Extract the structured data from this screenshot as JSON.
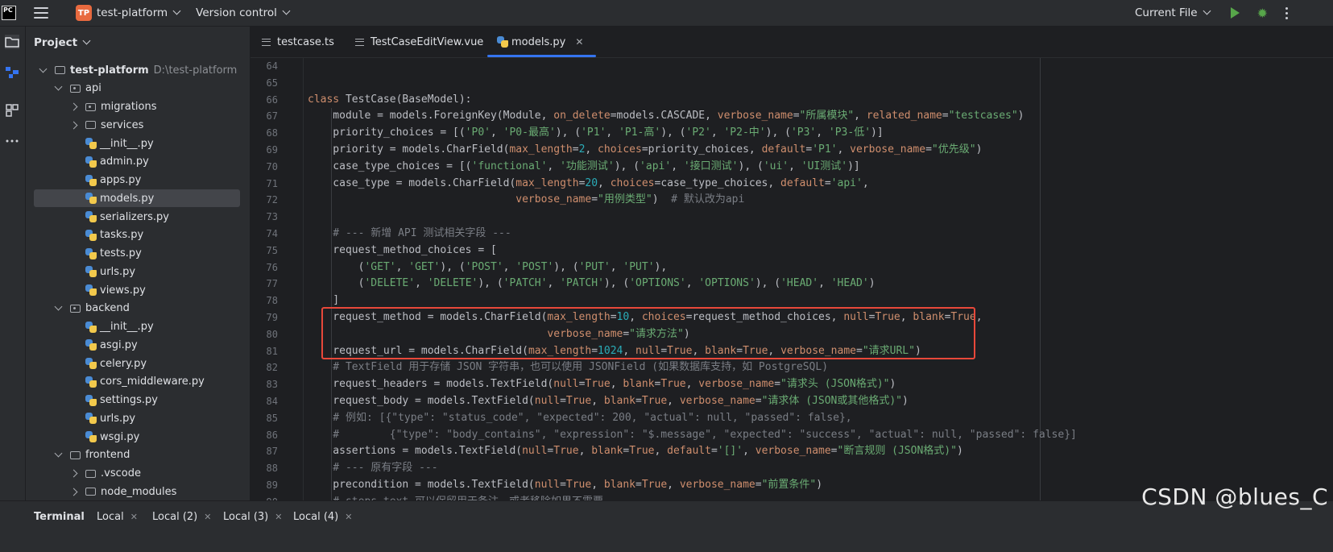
{
  "titlebar": {
    "app_logo": "PC",
    "project_badge": "TP",
    "project_name": "test-platform",
    "version_control": "Version control",
    "run_config": "Current File"
  },
  "project_panel": {
    "title": "Project",
    "tree": [
      {
        "label": "test-platform",
        "path": "D:\\test-platform",
        "type": "folder",
        "expanded": true,
        "bold": true
      },
      {
        "label": "api",
        "type": "package",
        "expanded": true
      },
      {
        "label": "migrations",
        "type": "package",
        "expanded": false
      },
      {
        "label": "services",
        "type": "folder",
        "expanded": false
      },
      {
        "label": "__init__.py",
        "type": "py"
      },
      {
        "label": "admin.py",
        "type": "py"
      },
      {
        "label": "apps.py",
        "type": "py"
      },
      {
        "label": "models.py",
        "type": "py",
        "selected": true
      },
      {
        "label": "serializers.py",
        "type": "py"
      },
      {
        "label": "tasks.py",
        "type": "py"
      },
      {
        "label": "tests.py",
        "type": "py"
      },
      {
        "label": "urls.py",
        "type": "py"
      },
      {
        "label": "views.py",
        "type": "py"
      },
      {
        "label": "backend",
        "type": "package",
        "expanded": true
      },
      {
        "label": "__init__.py",
        "type": "py"
      },
      {
        "label": "asgi.py",
        "type": "py"
      },
      {
        "label": "celery.py",
        "type": "py"
      },
      {
        "label": "cors_middleware.py",
        "type": "py"
      },
      {
        "label": "settings.py",
        "type": "py"
      },
      {
        "label": "urls.py",
        "type": "py"
      },
      {
        "label": "wsgi.py",
        "type": "py"
      },
      {
        "label": "frontend",
        "type": "folder",
        "expanded": true
      },
      {
        "label": ".vscode",
        "type": "folder",
        "expanded": false
      },
      {
        "label": "node_modules",
        "type": "folder",
        "expanded": false
      }
    ]
  },
  "tabs": [
    {
      "label": "testcase.ts",
      "active": false
    },
    {
      "label": "TestCaseEditView.vue",
      "active": false
    },
    {
      "label": "models.py",
      "active": true
    }
  ],
  "editor": {
    "lines": [
      {
        "n": "64",
        "tokens": []
      },
      {
        "n": "65",
        "tokens": []
      },
      {
        "n": "66",
        "tokens": [
          [
            "k",
            "class "
          ],
          [
            "t",
            "TestCase(BaseModel):"
          ]
        ]
      },
      {
        "n": "67",
        "tokens": [
          [
            "t",
            "    module = models.ForeignKey(Module, "
          ],
          [
            "k",
            "on_delete"
          ],
          [
            "t",
            "=models.CASCADE, "
          ],
          [
            "k",
            "verbose_name"
          ],
          [
            "t",
            "="
          ],
          [
            "s",
            "\"所属模块\""
          ],
          [
            "t",
            ", "
          ],
          [
            "k",
            "related_name"
          ],
          [
            "t",
            "="
          ],
          [
            "s",
            "\"testcases\""
          ],
          [
            "t",
            ")"
          ]
        ]
      },
      {
        "n": "68",
        "tokens": [
          [
            "t",
            "    priority_choices = [("
          ],
          [
            "s",
            "'P0'"
          ],
          [
            "t",
            ", "
          ],
          [
            "s",
            "'P0-最高'"
          ],
          [
            "t",
            "), ("
          ],
          [
            "s",
            "'P1'"
          ],
          [
            "t",
            ", "
          ],
          [
            "s",
            "'P1-高'"
          ],
          [
            "t",
            "), ("
          ],
          [
            "s",
            "'P2'"
          ],
          [
            "t",
            ", "
          ],
          [
            "s",
            "'P2-中'"
          ],
          [
            "t",
            "), ("
          ],
          [
            "s",
            "'P3'"
          ],
          [
            "t",
            ", "
          ],
          [
            "s",
            "'P3-低'"
          ],
          [
            "t",
            ")]"
          ]
        ]
      },
      {
        "n": "69",
        "tokens": [
          [
            "t",
            "    priority = models.CharField("
          ],
          [
            "k",
            "max_length"
          ],
          [
            "t",
            "="
          ],
          [
            "n",
            "2"
          ],
          [
            "t",
            ", "
          ],
          [
            "k",
            "choices"
          ],
          [
            "t",
            "=priority_choices, "
          ],
          [
            "k",
            "default"
          ],
          [
            "t",
            "="
          ],
          [
            "s",
            "'P1'"
          ],
          [
            "t",
            ", "
          ],
          [
            "k",
            "verbose_name"
          ],
          [
            "t",
            "="
          ],
          [
            "s",
            "\"优先级\""
          ],
          [
            "t",
            ")"
          ]
        ]
      },
      {
        "n": "70",
        "tokens": [
          [
            "t",
            "    case_type_choices = [("
          ],
          [
            "s",
            "'functional'"
          ],
          [
            "t",
            ", "
          ],
          [
            "s",
            "'功能测试'"
          ],
          [
            "t",
            "), ("
          ],
          [
            "s",
            "'api'"
          ],
          [
            "t",
            ", "
          ],
          [
            "s",
            "'接口测试'"
          ],
          [
            "t",
            "), ("
          ],
          [
            "s",
            "'ui'"
          ],
          [
            "t",
            ", "
          ],
          [
            "s",
            "'UI测试'"
          ],
          [
            "t",
            ")]"
          ]
        ]
      },
      {
        "n": "71",
        "tokens": [
          [
            "t",
            "    case_type = models.CharField("
          ],
          [
            "k",
            "max_length"
          ],
          [
            "t",
            "="
          ],
          [
            "n",
            "20"
          ],
          [
            "t",
            ", "
          ],
          [
            "k",
            "choices"
          ],
          [
            "t",
            "=case_type_choices, "
          ],
          [
            "k",
            "default"
          ],
          [
            "t",
            "="
          ],
          [
            "s",
            "'api'"
          ],
          [
            "t",
            ","
          ]
        ]
      },
      {
        "n": "72",
        "tokens": [
          [
            "t",
            "                                 "
          ],
          [
            "k",
            "verbose_name"
          ],
          [
            "t",
            "="
          ],
          [
            "s",
            "\"用例类型\""
          ],
          [
            "t",
            ")  "
          ],
          [
            "c",
            "# 默认改为api"
          ]
        ]
      },
      {
        "n": "73",
        "tokens": []
      },
      {
        "n": "74",
        "tokens": [
          [
            "c",
            "    # --- 新增 API 测试相关字段 ---"
          ]
        ]
      },
      {
        "n": "75",
        "tokens": [
          [
            "t",
            "    request_method_choices = ["
          ]
        ]
      },
      {
        "n": "76",
        "tokens": [
          [
            "t",
            "        ("
          ],
          [
            "s",
            "'GET'"
          ],
          [
            "t",
            ", "
          ],
          [
            "s",
            "'GET'"
          ],
          [
            "t",
            "), ("
          ],
          [
            "s",
            "'POST'"
          ],
          [
            "t",
            ", "
          ],
          [
            "s",
            "'POST'"
          ],
          [
            "t",
            "), ("
          ],
          [
            "s",
            "'PUT'"
          ],
          [
            "t",
            ", "
          ],
          [
            "s",
            "'PUT'"
          ],
          [
            "t",
            "),"
          ]
        ]
      },
      {
        "n": "77",
        "tokens": [
          [
            "t",
            "        ("
          ],
          [
            "s",
            "'DELETE'"
          ],
          [
            "t",
            ", "
          ],
          [
            "s",
            "'DELETE'"
          ],
          [
            "t",
            "), ("
          ],
          [
            "s",
            "'PATCH'"
          ],
          [
            "t",
            ", "
          ],
          [
            "s",
            "'PATCH'"
          ],
          [
            "t",
            "), ("
          ],
          [
            "s",
            "'OPTIONS'"
          ],
          [
            "t",
            ", "
          ],
          [
            "s",
            "'OPTIONS'"
          ],
          [
            "t",
            "), ("
          ],
          [
            "s",
            "'HEAD'"
          ],
          [
            "t",
            ", "
          ],
          [
            "s",
            "'HEAD'"
          ],
          [
            "t",
            ")"
          ]
        ]
      },
      {
        "n": "78",
        "tokens": [
          [
            "t",
            "    ]"
          ]
        ]
      },
      {
        "n": "79",
        "tokens": [
          [
            "t",
            "    request_method = models.CharField("
          ],
          [
            "k",
            "max_length"
          ],
          [
            "t",
            "="
          ],
          [
            "n",
            "10"
          ],
          [
            "t",
            ", "
          ],
          [
            "k",
            "choices"
          ],
          [
            "t",
            "=request_method_choices, "
          ],
          [
            "k",
            "null"
          ],
          [
            "t",
            "="
          ],
          [
            "k",
            "True"
          ],
          [
            "t",
            ", "
          ],
          [
            "k",
            "blank"
          ],
          [
            "t",
            "="
          ],
          [
            "k",
            "True"
          ],
          [
            "t",
            ","
          ]
        ]
      },
      {
        "n": "80",
        "tokens": [
          [
            "t",
            "                                      "
          ],
          [
            "k",
            "verbose_name"
          ],
          [
            "t",
            "="
          ],
          [
            "s",
            "\"请求方法\""
          ],
          [
            "t",
            ")"
          ]
        ]
      },
      {
        "n": "81",
        "tokens": [
          [
            "t",
            "    request_url = models.CharField("
          ],
          [
            "k",
            "max_length"
          ],
          [
            "t",
            "="
          ],
          [
            "n",
            "1024"
          ],
          [
            "t",
            ", "
          ],
          [
            "k",
            "null"
          ],
          [
            "t",
            "="
          ],
          [
            "k",
            "True"
          ],
          [
            "t",
            ", "
          ],
          [
            "k",
            "blank"
          ],
          [
            "t",
            "="
          ],
          [
            "k",
            "True"
          ],
          [
            "t",
            ", "
          ],
          [
            "k",
            "verbose_name"
          ],
          [
            "t",
            "="
          ],
          [
            "s",
            "\"请求URL\""
          ],
          [
            "t",
            ")"
          ]
        ]
      },
      {
        "n": "82",
        "tokens": [
          [
            "c",
            "    # TextField 用于存储 JSON 字符串，也可以使用 JSONField (如果数据库支持，如 PostgreSQL)"
          ]
        ]
      },
      {
        "n": "83",
        "tokens": [
          [
            "t",
            "    request_headers = models.TextField("
          ],
          [
            "k",
            "null"
          ],
          [
            "t",
            "="
          ],
          [
            "k",
            "True"
          ],
          [
            "t",
            ", "
          ],
          [
            "k",
            "blank"
          ],
          [
            "t",
            "="
          ],
          [
            "k",
            "True"
          ],
          [
            "t",
            ", "
          ],
          [
            "k",
            "verbose_name"
          ],
          [
            "t",
            "="
          ],
          [
            "s",
            "\"请求头 (JSON格式)\""
          ],
          [
            "t",
            ")"
          ]
        ]
      },
      {
        "n": "84",
        "tokens": [
          [
            "t",
            "    request_body = models.TextField("
          ],
          [
            "k",
            "null"
          ],
          [
            "t",
            "="
          ],
          [
            "k",
            "True"
          ],
          [
            "t",
            ", "
          ],
          [
            "k",
            "blank"
          ],
          [
            "t",
            "="
          ],
          [
            "k",
            "True"
          ],
          [
            "t",
            ", "
          ],
          [
            "k",
            "verbose_name"
          ],
          [
            "t",
            "="
          ],
          [
            "s",
            "\"请求体 (JSON或其他格式)\""
          ],
          [
            "t",
            ")"
          ]
        ]
      },
      {
        "n": "85",
        "tokens": [
          [
            "c",
            "    # 例如: [{\"type\": \"status_code\", \"expected\": 200, \"actual\": null, \"passed\": false},"
          ]
        ]
      },
      {
        "n": "86",
        "tokens": [
          [
            "c",
            "    #        {\"type\": \"body_contains\", \"expression\": \"$.message\", \"expected\": \"success\", \"actual\": null, \"passed\": false}]"
          ]
        ]
      },
      {
        "n": "87",
        "tokens": [
          [
            "t",
            "    assertions = models.TextField("
          ],
          [
            "k",
            "null"
          ],
          [
            "t",
            "="
          ],
          [
            "k",
            "True"
          ],
          [
            "t",
            ", "
          ],
          [
            "k",
            "blank"
          ],
          [
            "t",
            "="
          ],
          [
            "k",
            "True"
          ],
          [
            "t",
            ", "
          ],
          [
            "k",
            "default"
          ],
          [
            "t",
            "="
          ],
          [
            "s",
            "'[]'"
          ],
          [
            "t",
            ", "
          ],
          [
            "k",
            "verbose_name"
          ],
          [
            "t",
            "="
          ],
          [
            "s",
            "\"断言规则 (JSON格式)\""
          ],
          [
            "t",
            ")"
          ]
        ]
      },
      {
        "n": "88",
        "tokens": [
          [
            "c",
            "    # --- 原有字段 ---"
          ]
        ]
      },
      {
        "n": "89",
        "tokens": [
          [
            "t",
            "    precondition = models.TextField("
          ],
          [
            "k",
            "null"
          ],
          [
            "t",
            "="
          ],
          [
            "k",
            "True"
          ],
          [
            "t",
            ", "
          ],
          [
            "k",
            "blank"
          ],
          [
            "t",
            "="
          ],
          [
            "k",
            "True"
          ],
          [
            "t",
            ", "
          ],
          [
            "k",
            "verbose_name"
          ],
          [
            "t",
            "="
          ],
          [
            "s",
            "\"前置条件\""
          ],
          [
            "t",
            ")"
          ]
        ]
      },
      {
        "n": "90",
        "tokens": [
          [
            "c",
            "    # steps_text 可以保留用于备注，或者移除如果不需要"
          ]
        ]
      }
    ]
  },
  "bottom_bar": {
    "tabs": [
      "Terminal",
      "Local",
      "Local (2)",
      "Local (3)",
      "Local (4)"
    ]
  },
  "watermark": "CSDN @blues_C",
  "colors": {
    "accent": "#3574f0",
    "highlight_box": "#e8483a",
    "run_green": "#57a64a"
  }
}
